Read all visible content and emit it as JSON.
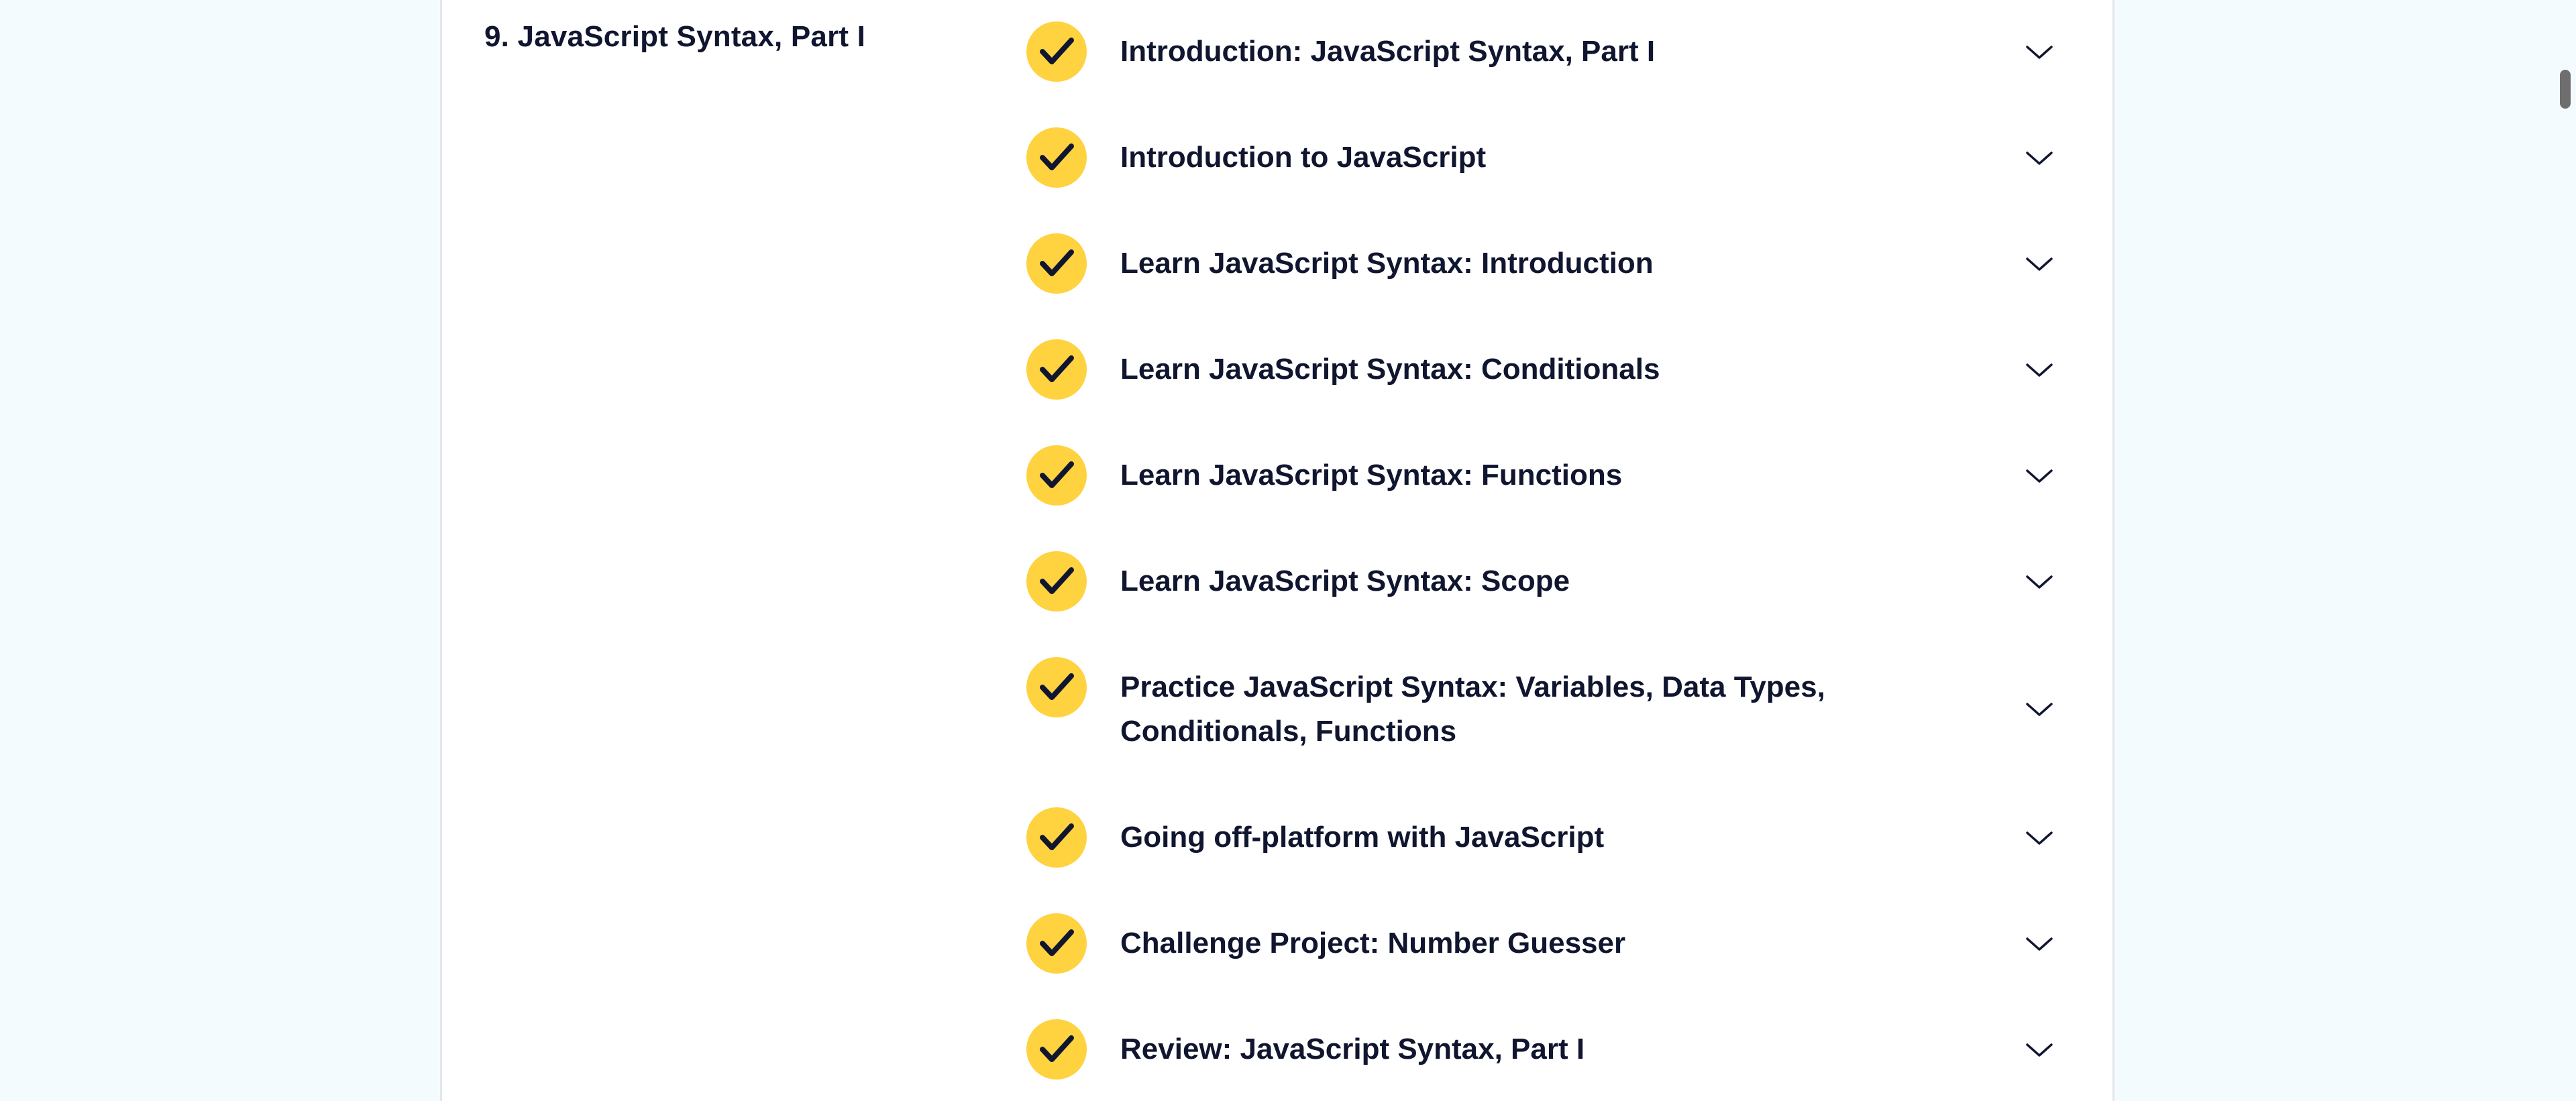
{
  "module": {
    "title": "9. JavaScript Syntax, Part I"
  },
  "lessons": [
    {
      "label": "Introduction: JavaScript Syntax, Part I",
      "completed": true
    },
    {
      "label": "Introduction to JavaScript",
      "completed": true
    },
    {
      "label": "Learn JavaScript Syntax: Introduction",
      "completed": true
    },
    {
      "label": "Learn JavaScript Syntax: Conditionals",
      "completed": true
    },
    {
      "label": "Learn JavaScript Syntax: Functions",
      "completed": true
    },
    {
      "label": "Learn JavaScript Syntax: Scope",
      "completed": true
    },
    {
      "label": "Practice JavaScript Syntax: Variables, Data Types, Conditionals, Functions",
      "completed": true
    },
    {
      "label": "Going off-platform with JavaScript",
      "completed": true
    },
    {
      "label": "Challenge Project: Number Guesser",
      "completed": true
    },
    {
      "label": "Review: JavaScript Syntax, Part I",
      "completed": true
    }
  ],
  "icons": {
    "completed": "checkmark-icon",
    "expand": "chevron-down-icon"
  },
  "colors": {
    "page_background": "#f3fbfe",
    "card_background": "#ffffff",
    "check_badge": "#ffd23f",
    "text": "#10162f"
  }
}
